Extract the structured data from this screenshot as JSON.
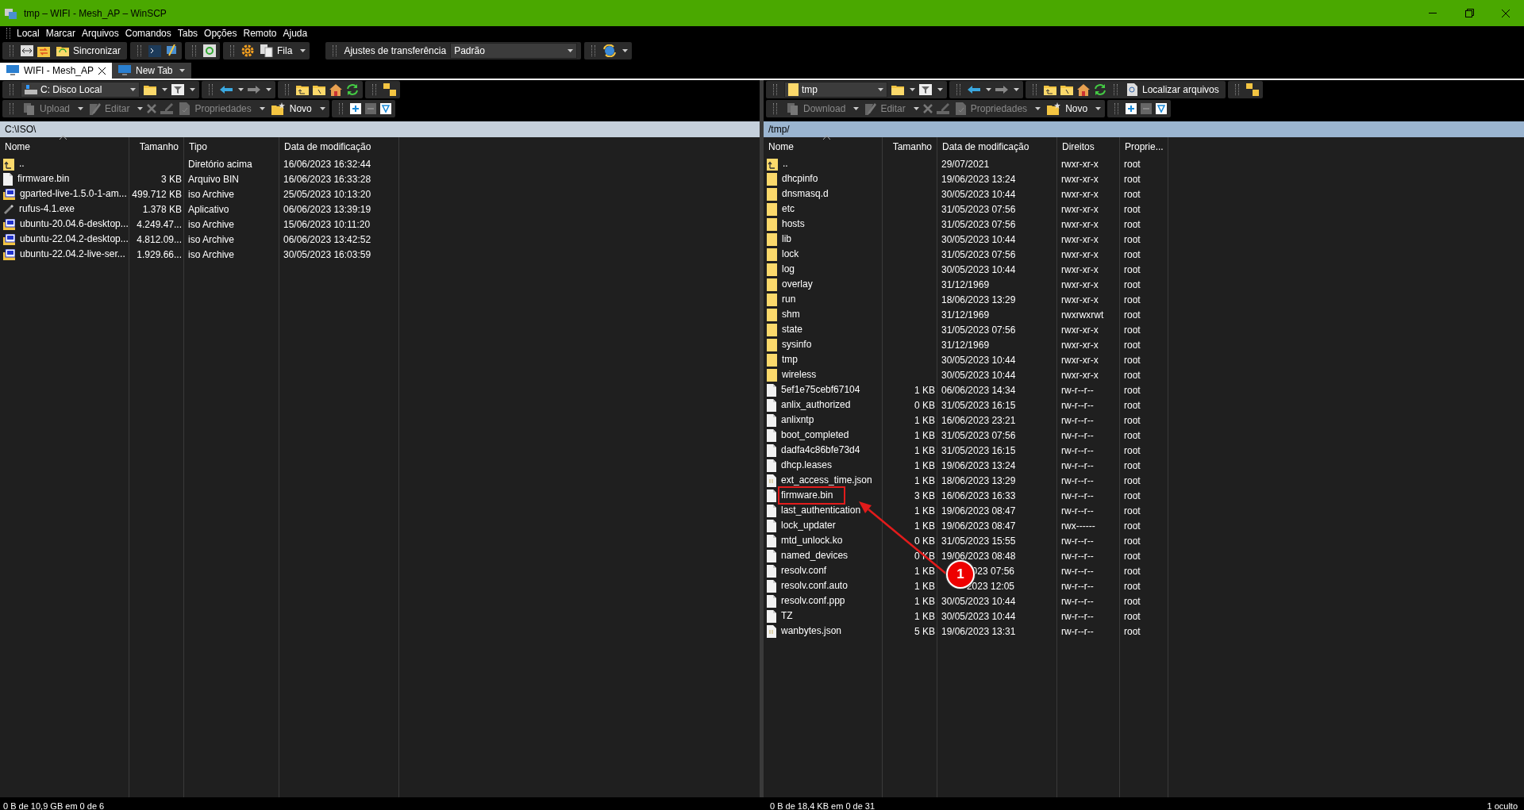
{
  "window": {
    "title": "tmp – WIFI - Mesh_AP – WinSCP"
  },
  "menu": [
    "Local",
    "Marcar",
    "Arquivos",
    "Comandos",
    "Tabs",
    "Opções",
    "Remoto",
    "Ajuda"
  ],
  "toolbar": {
    "sync_label": "Sincronizar",
    "queue_label": "Fila",
    "transfer_label": "Ajustes de transferência",
    "transfer_value": "Padrão"
  },
  "tabs": [
    {
      "label": "WIFI - Mesh_AP",
      "selected": true
    },
    {
      "label": "New Tab",
      "selected": false
    }
  ],
  "panels": [
    {
      "kind": "local",
      "active": false,
      "location": "C: Disco Local",
      "actions": [
        {
          "kind": "transfer",
          "label": "Upload",
          "disabled": true
        },
        {
          "kind": "edit",
          "label": "Editar",
          "disabled": true
        },
        {
          "kind": "props",
          "label": "Propriedades",
          "disabled": true
        },
        {
          "kind": "new",
          "label": "Novo",
          "disabled": false
        }
      ],
      "path": "C:\\ISO\\",
      "columns": [
        "Nome",
        "Tamanho",
        "Tipo",
        "Data de modificação"
      ],
      "rows": [
        {
          "kind": "up",
          "cells": [
            "..",
            "",
            "Diretório acima",
            "16/06/2023 16:32:44"
          ],
          "boxed": false
        },
        {
          "kind": "file",
          "cells": [
            "firmware.bin",
            "3 KB",
            "Arquivo BIN",
            "16/06/2023 16:33:28"
          ],
          "boxed": false
        },
        {
          "kind": "iso",
          "cells": [
            "gparted-live-1.5.0-1-am...",
            "499.712 KB",
            "iso Archive",
            "25/05/2023 10:13:20"
          ],
          "boxed": false
        },
        {
          "kind": "exe",
          "cells": [
            "rufus-4.1.exe",
            "1.378 KB",
            "Aplicativo",
            "06/06/2023 13:39:19"
          ],
          "boxed": false
        },
        {
          "kind": "iso",
          "cells": [
            "ubuntu-20.04.6-desktop...",
            "4.249.47...",
            "iso Archive",
            "15/06/2023 10:11:20"
          ],
          "boxed": false
        },
        {
          "kind": "iso",
          "cells": [
            "ubuntu-22.04.2-desktop...",
            "4.812.09...",
            "iso Archive",
            "06/06/2023 13:42:52"
          ],
          "boxed": false
        },
        {
          "kind": "iso",
          "cells": [
            "ubuntu-22.04.2-live-ser...",
            "1.929.66...",
            "iso Archive",
            "30/05/2023 16:03:59"
          ],
          "boxed": false
        }
      ],
      "status": "0 B de 10,9 GB em 0 de 6"
    },
    {
      "kind": "remote",
      "active": true,
      "location": "tmp",
      "search_label": "Localizar arquivos",
      "actions": [
        {
          "kind": "transfer",
          "label": "Download",
          "disabled": true
        },
        {
          "kind": "edit",
          "label": "Editar",
          "disabled": true
        },
        {
          "kind": "props",
          "label": "Propriedades",
          "disabled": true
        },
        {
          "kind": "new",
          "label": "Novo",
          "disabled": false
        }
      ],
      "path": "/tmp/",
      "columns": [
        "Nome",
        "Tamanho",
        "Data de modificação",
        "Direitos",
        "Proprie..."
      ],
      "rows": [
        {
          "kind": "up",
          "cells": [
            "..",
            "",
            "29/07/2021",
            "rwxr-xr-x",
            "root"
          ],
          "boxed": false
        },
        {
          "kind": "folder",
          "cells": [
            "dhcpinfo",
            "",
            "19/06/2023 13:24",
            "rwxr-xr-x",
            "root"
          ],
          "boxed": false
        },
        {
          "kind": "folder",
          "cells": [
            "dnsmasq.d",
            "",
            "30/05/2023 10:44",
            "rwxr-xr-x",
            "root"
          ],
          "boxed": false
        },
        {
          "kind": "folder",
          "cells": [
            "etc",
            "",
            "31/05/2023 07:56",
            "rwxr-xr-x",
            "root"
          ],
          "boxed": false
        },
        {
          "kind": "folder",
          "cells": [
            "hosts",
            "",
            "31/05/2023 07:56",
            "rwxr-xr-x",
            "root"
          ],
          "boxed": false
        },
        {
          "kind": "folder",
          "cells": [
            "lib",
            "",
            "30/05/2023 10:44",
            "rwxr-xr-x",
            "root"
          ],
          "boxed": false
        },
        {
          "kind": "folder",
          "cells": [
            "lock",
            "",
            "31/05/2023 07:56",
            "rwxr-xr-x",
            "root"
          ],
          "boxed": false
        },
        {
          "kind": "folder",
          "cells": [
            "log",
            "",
            "30/05/2023 10:44",
            "rwxr-xr-x",
            "root"
          ],
          "boxed": false
        },
        {
          "kind": "folder",
          "cells": [
            "overlay",
            "",
            "31/12/1969",
            "rwxr-xr-x",
            "root"
          ],
          "boxed": false
        },
        {
          "kind": "folder",
          "cells": [
            "run",
            "",
            "18/06/2023 13:29",
            "rwxr-xr-x",
            "root"
          ],
          "boxed": false
        },
        {
          "kind": "folder",
          "cells": [
            "shm",
            "",
            "31/12/1969",
            "rwxrwxrwt",
            "root"
          ],
          "boxed": false
        },
        {
          "kind": "folder",
          "cells": [
            "state",
            "",
            "31/05/2023 07:56",
            "rwxr-xr-x",
            "root"
          ],
          "boxed": false
        },
        {
          "kind": "folder",
          "cells": [
            "sysinfo",
            "",
            "31/12/1969",
            "rwxr-xr-x",
            "root"
          ],
          "boxed": false
        },
        {
          "kind": "folder",
          "cells": [
            "tmp",
            "",
            "30/05/2023 10:44",
            "rwxr-xr-x",
            "root"
          ],
          "boxed": false
        },
        {
          "kind": "folder",
          "cells": [
            "wireless",
            "",
            "30/05/2023 10:44",
            "rwxr-xr-x",
            "root"
          ],
          "boxed": false
        },
        {
          "kind": "file",
          "cells": [
            "5ef1e75cebf67104",
            "1 KB",
            "06/06/2023 14:34",
            "rw-r--r--",
            "root"
          ],
          "boxed": false
        },
        {
          "kind": "file",
          "cells": [
            "anlix_authorized",
            "0 KB",
            "31/05/2023 16:15",
            "rw-r--r--",
            "root"
          ],
          "boxed": false
        },
        {
          "kind": "file",
          "cells": [
            "anlixntp",
            "1 KB",
            "16/06/2023 23:21",
            "rw-r--r--",
            "root"
          ],
          "boxed": false
        },
        {
          "kind": "file",
          "cells": [
            "boot_completed",
            "1 KB",
            "31/05/2023 07:56",
            "rw-r--r--",
            "root"
          ],
          "boxed": false
        },
        {
          "kind": "file",
          "cells": [
            "dadfa4c86bfe73d4",
            "1 KB",
            "31/05/2023 16:15",
            "rw-r--r--",
            "root"
          ],
          "boxed": false
        },
        {
          "kind": "file",
          "cells": [
            "dhcp.leases",
            "1 KB",
            "19/06/2023 13:24",
            "rw-r--r--",
            "root"
          ],
          "boxed": false
        },
        {
          "kind": "json",
          "cells": [
            "ext_access_time.json",
            "1 KB",
            "18/06/2023 13:29",
            "rw-r--r--",
            "root"
          ],
          "boxed": false
        },
        {
          "kind": "file",
          "cells": [
            "firmware.bin",
            "3 KB",
            "16/06/2023 16:33",
            "rw-r--r--",
            "root"
          ],
          "boxed": true
        },
        {
          "kind": "file",
          "cells": [
            "last_authentication",
            "1 KB",
            "19/06/2023 08:47",
            "rw-r--r--",
            "root"
          ],
          "boxed": false
        },
        {
          "kind": "file",
          "cells": [
            "lock_updater",
            "1 KB",
            "19/06/2023 08:47",
            "rwx------",
            "root"
          ],
          "boxed": false
        },
        {
          "kind": "file",
          "cells": [
            "mtd_unlock.ko",
            "0 KB",
            "31/05/2023 15:55",
            "rw-r--r--",
            "root"
          ],
          "boxed": false
        },
        {
          "kind": "file",
          "cells": [
            "named_devices",
            "0 KB",
            "19/06/2023 08:48",
            "rw-r--r--",
            "root"
          ],
          "boxed": false
        },
        {
          "kind": "file",
          "cells": [
            "resolv.conf",
            "1 KB",
            "023 07:56",
            "rw-r--r--",
            "root"
          ],
          "boxed": false
        },
        {
          "kind": "file",
          "cells": [
            "resolv.conf.auto",
            "1 KB",
            "2023 12:05",
            "rw-r--r--",
            "root"
          ],
          "boxed": false
        },
        {
          "kind": "file",
          "cells": [
            "resolv.conf.ppp",
            "1 KB",
            "30/05/2023 10:44",
            "rw-r--r--",
            "root"
          ],
          "boxed": false
        },
        {
          "kind": "file",
          "cells": [
            "TZ",
            "1 KB",
            "30/05/2023 10:44",
            "rw-r--r--",
            "root"
          ],
          "boxed": false
        },
        {
          "kind": "json",
          "cells": [
            "wanbytes.json",
            "5 KB",
            "19/06/2023 13:31",
            "rw-r--r--",
            "root"
          ],
          "boxed": false
        }
      ],
      "status": "0 B de 18,4 KB em 0 de 31",
      "hidden_status": "1 oculto"
    }
  ],
  "callout": {
    "label": "1"
  }
}
